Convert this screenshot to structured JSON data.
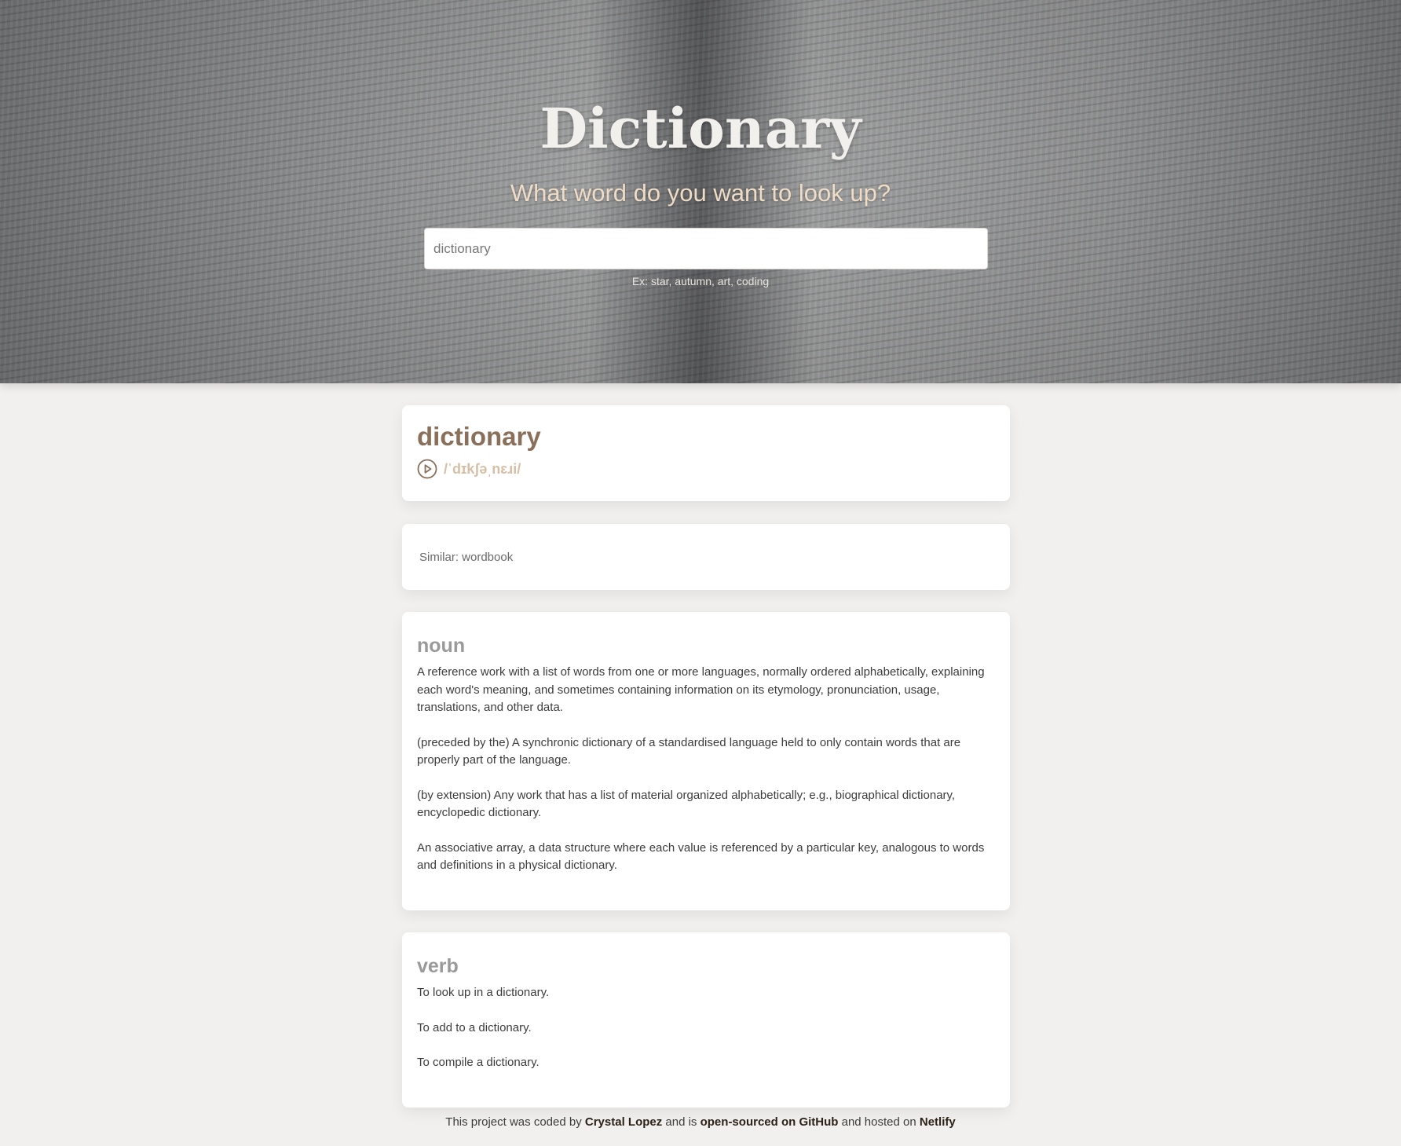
{
  "header": {
    "title": "Dictionary",
    "subtitle": "What word do you want to look up?",
    "search": {
      "value": "dictionary"
    },
    "hint": "Ex: star, autumn, art, coding"
  },
  "word": {
    "title": "dictionary",
    "phonetic": "/ˈdɪkʃəˌnɛɹi/",
    "play_icon": "play-circle-icon"
  },
  "similar": {
    "text": "Similar: wordbook"
  },
  "meanings": [
    {
      "part_of_speech": "noun",
      "definitions": [
        "A reference work with a list of words from one or more languages, normally ordered alphabetically, explaining each word's meaning, and sometimes containing information on its etymology, pronunciation, usage, translations, and other data.",
        "(preceded by the) A synchronic dictionary of a standardised language held to only contain words that are properly part of the language.",
        "(by extension) Any work that has a list of material organized alphabetically; e.g., biographical dictionary, encyclopedic dictionary.",
        "An associative array, a data structure where each value is referenced by a particular key, analogous to words and definitions in a physical dictionary."
      ]
    },
    {
      "part_of_speech": "verb",
      "definitions": [
        "To look up in a dictionary.",
        "To add to a dictionary.",
        "To compile a dictionary."
      ]
    }
  ],
  "footer": {
    "text1": "This project was coded by ",
    "author_link": "Crystal Lopez",
    "text2": " and is ",
    "github_link": "open-sourced on GitHub",
    "text3": " and hosted on ",
    "netlify_link": "Netlify"
  },
  "colors": {
    "word_title": "#8a6f5b",
    "phonetic": "#d7bfa6",
    "subtitle": "#efdcc6",
    "background": "#f1f0ee"
  }
}
